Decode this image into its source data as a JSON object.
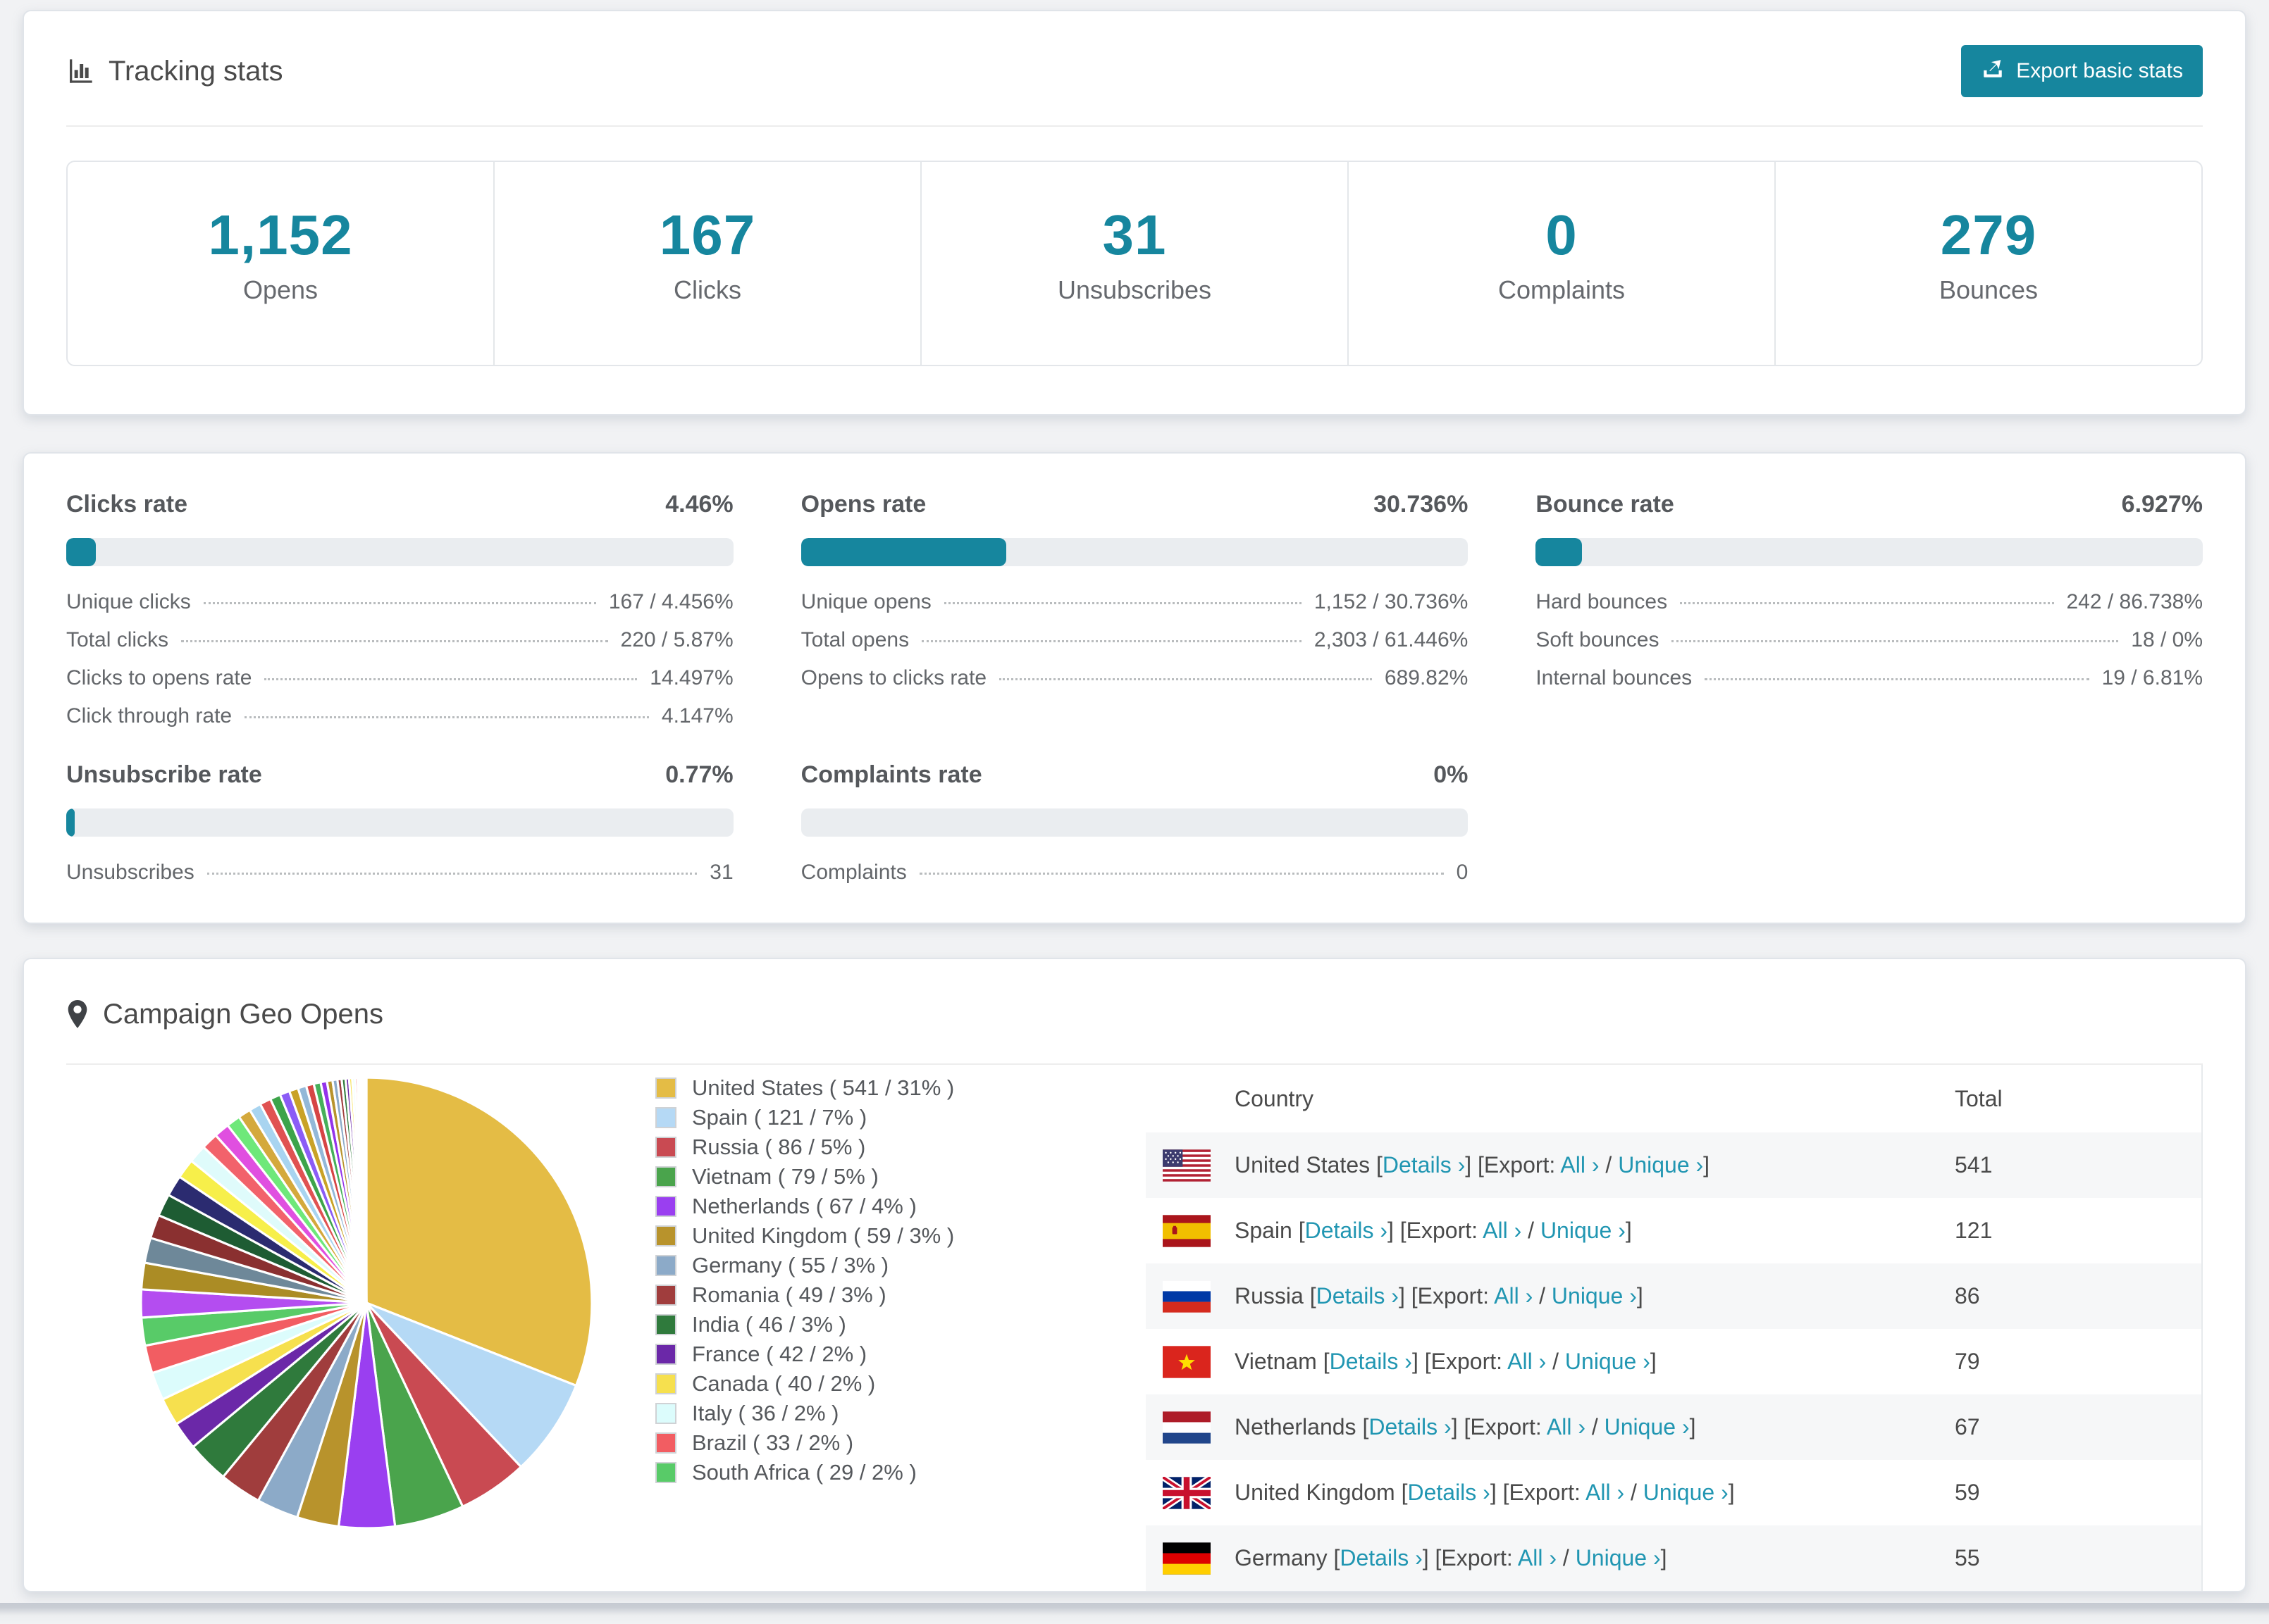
{
  "accent_color": "#16869e",
  "link_color": "#2196b2",
  "header": {
    "title": "Tracking stats",
    "export_label": "Export basic stats"
  },
  "summary_stats": [
    {
      "value": "1,152",
      "label": "Opens"
    },
    {
      "value": "167",
      "label": "Clicks"
    },
    {
      "value": "31",
      "label": "Unsubscribes"
    },
    {
      "value": "0",
      "label": "Complaints"
    },
    {
      "value": "279",
      "label": "Bounces"
    }
  ],
  "rate_sections": [
    {
      "title": "Clicks rate",
      "value": "4.46%",
      "percent": 4.46,
      "rows": [
        {
          "label": "Unique clicks",
          "value": "167 / 4.456%"
        },
        {
          "label": "Total clicks",
          "value": "220 / 5.87%"
        },
        {
          "label": "Clicks to opens rate",
          "value": "14.497%"
        },
        {
          "label": "Click through rate",
          "value": "4.147%"
        }
      ]
    },
    {
      "title": "Opens rate",
      "value": "30.736%",
      "percent": 30.736,
      "rows": [
        {
          "label": "Unique opens",
          "value": "1,152 / 30.736%"
        },
        {
          "label": "Total opens",
          "value": "2,303 / 61.446%"
        },
        {
          "label": "Opens to clicks rate",
          "value": "689.82%"
        }
      ]
    },
    {
      "title": "Bounce rate",
      "value": "6.927%",
      "percent": 6.927,
      "rows": [
        {
          "label": "Hard bounces",
          "value": "242 / 86.738%"
        },
        {
          "label": "Soft bounces",
          "value": "18 / 0%"
        },
        {
          "label": "Internal bounces",
          "value": "19 / 6.81%"
        }
      ]
    },
    {
      "title": "Unsubscribe rate",
      "value": "0.77%",
      "percent": 0.77,
      "rows": [
        {
          "label": "Unsubscribes",
          "value": "31"
        }
      ]
    },
    {
      "title": "Complaints rate",
      "value": "0%",
      "percent": 0,
      "rows": [
        {
          "label": "Complaints",
          "value": "0"
        }
      ]
    }
  ],
  "geo": {
    "title": "Campaign Geo Opens",
    "table": {
      "columns": [
        "Country",
        "Total"
      ],
      "labels": {
        "details": "Details",
        "export": "Export:",
        "all": "All",
        "unique": "Unique",
        "chevron": "›"
      },
      "rows": [
        {
          "country": "United States",
          "flag": "us",
          "total": "541"
        },
        {
          "country": "Spain",
          "flag": "es",
          "total": "121"
        },
        {
          "country": "Russia",
          "flag": "ru",
          "total": "86"
        },
        {
          "country": "Vietnam",
          "flag": "vn",
          "total": "79"
        },
        {
          "country": "Netherlands",
          "flag": "nl",
          "total": "67"
        },
        {
          "country": "United Kingdom",
          "flag": "gb",
          "total": "59"
        },
        {
          "country": "Germany",
          "flag": "de",
          "total": "55"
        }
      ]
    }
  },
  "chart_data": {
    "type": "pie",
    "title": "Campaign Geo Opens",
    "legend_position": "right",
    "slices": [
      {
        "name": "United States",
        "count": 541,
        "pct": 31,
        "color": "#e4bc45"
      },
      {
        "name": "Spain",
        "count": 121,
        "pct": 7,
        "color": "#b5d9f5"
      },
      {
        "name": "Russia",
        "count": 86,
        "pct": 5,
        "color": "#c94a52"
      },
      {
        "name": "Vietnam",
        "count": 79,
        "pct": 5,
        "color": "#4aa44c"
      },
      {
        "name": "Netherlands",
        "count": 67,
        "pct": 4,
        "color": "#9a3ff0"
      },
      {
        "name": "United Kingdom",
        "count": 59,
        "pct": 3,
        "color": "#b8932c"
      },
      {
        "name": "Germany",
        "count": 55,
        "pct": 3,
        "color": "#8caac8"
      },
      {
        "name": "Romania",
        "count": 49,
        "pct": 3,
        "color": "#a03d3d"
      },
      {
        "name": "India",
        "count": 46,
        "pct": 3,
        "color": "#2f7a3c"
      },
      {
        "name": "France",
        "count": 42,
        "pct": 2,
        "color": "#6b28a8"
      },
      {
        "name": "Canada",
        "count": 40,
        "pct": 2,
        "color": "#f6e04e"
      },
      {
        "name": "Italy",
        "count": 36,
        "pct": 2,
        "color": "#dcfcfc"
      },
      {
        "name": "Brazil",
        "count": 33,
        "pct": 2,
        "color": "#f25d62"
      },
      {
        "name": "South Africa",
        "count": 29,
        "pct": 2,
        "color": "#58cb68"
      }
    ],
    "other_slices": [
      {
        "value": 2.0,
        "color": "#b44df0"
      },
      {
        "value": 1.9,
        "color": "#ab8c25"
      },
      {
        "value": 1.8,
        "color": "#6e8899"
      },
      {
        "value": 1.7,
        "color": "#8a3030"
      },
      {
        "value": 1.6,
        "color": "#1e5c33"
      },
      {
        "value": 1.5,
        "color": "#2b2b70"
      },
      {
        "value": 1.4,
        "color": "#f7ef4a"
      },
      {
        "value": 1.3,
        "color": "#dffbfb"
      },
      {
        "value": 1.2,
        "color": "#f2626b"
      },
      {
        "value": 1.1,
        "color": "#e04fe0"
      },
      {
        "value": 1.0,
        "color": "#6ee87a"
      },
      {
        "value": 0.9,
        "color": "#d4a93c"
      },
      {
        "value": 0.85,
        "color": "#a8d4f0"
      },
      {
        "value": 0.8,
        "color": "#e05252"
      },
      {
        "value": 0.75,
        "color": "#3da44a"
      },
      {
        "value": 0.7,
        "color": "#8b5cf6"
      },
      {
        "value": 0.65,
        "color": "#c9a227"
      },
      {
        "value": 0.6,
        "color": "#93b8d8"
      },
      {
        "value": 0.55,
        "color": "#d64545"
      },
      {
        "value": 0.5,
        "color": "#46b05a"
      },
      {
        "value": 0.45,
        "color": "#9333ea"
      },
      {
        "value": 0.4,
        "color": "#b8932c"
      },
      {
        "value": 0.35,
        "color": "#8caac8"
      },
      {
        "value": 0.3,
        "color": "#a03d3d"
      },
      {
        "value": 0.28,
        "color": "#2f7a3c"
      },
      {
        "value": 0.25,
        "color": "#6b28a8"
      },
      {
        "value": 0.22,
        "color": "#f6e04e"
      },
      {
        "value": 0.2,
        "color": "#dcfcfc"
      },
      {
        "value": 0.18,
        "color": "#f25d62"
      },
      {
        "value": 0.15,
        "color": "#58cb68"
      },
      {
        "value": 0.12,
        "color": "#c94a52"
      },
      {
        "value": 0.1,
        "color": "#e4bc45"
      },
      {
        "value": 0.08,
        "color": "#b5d9f5"
      },
      {
        "value": 0.06,
        "color": "#9a3ff0"
      },
      {
        "value": 0.05,
        "color": "#b8932c"
      },
      {
        "value": 0.04,
        "color": "#8caac8"
      },
      {
        "value": 0.03,
        "color": "#a03d3d"
      }
    ]
  }
}
